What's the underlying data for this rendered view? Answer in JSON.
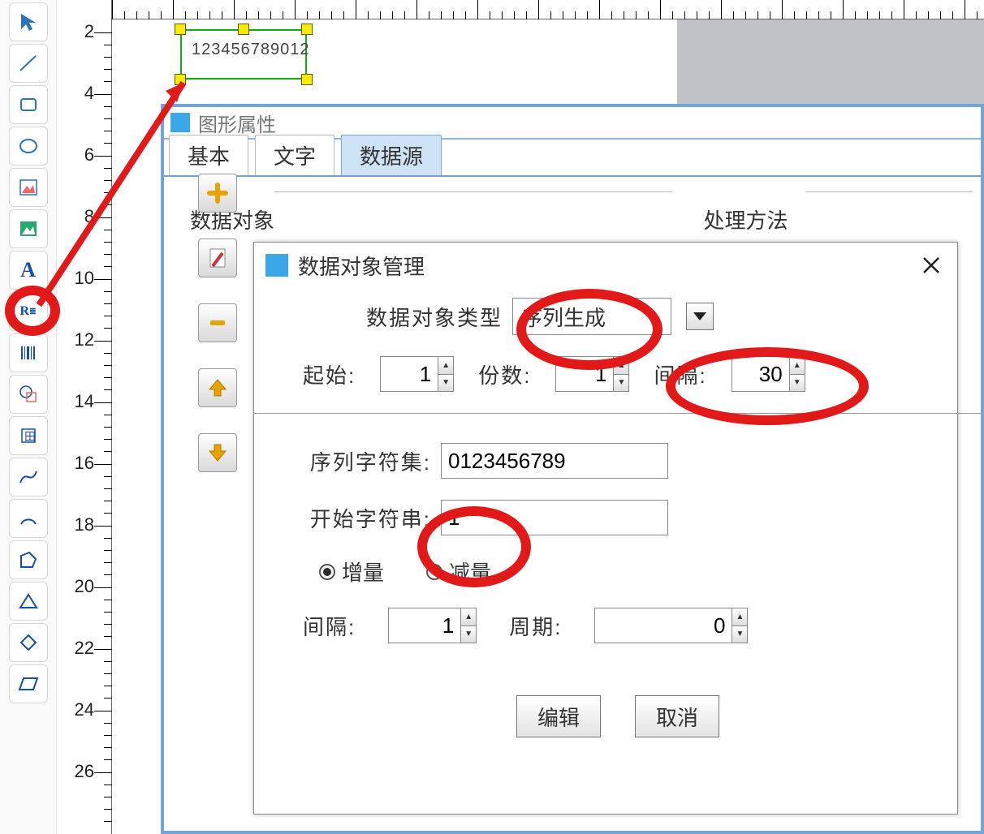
{
  "canvas": {
    "selected_text": "123456789012"
  },
  "ruler": {
    "v_ticks": [
      "2",
      "4",
      "6",
      "8",
      "10",
      "12",
      "14",
      "16",
      "18",
      "20",
      "22",
      "24",
      "26"
    ]
  },
  "prop_panel": {
    "title": "图形属性",
    "tabs": {
      "basic": "基本",
      "text": "文字",
      "datasrc": "数据源"
    },
    "group_left": "数据对象",
    "group_right": "处理方法"
  },
  "side_buttons": {
    "add": "＋",
    "edit": "✎",
    "remove": "−",
    "up": "↑",
    "down": "↓"
  },
  "dlg": {
    "title": "数据对象管理",
    "type_label": "数据对象类型",
    "type_value": "序列生成",
    "start_label": "起始:",
    "start_value": "1",
    "copies_label": "份数:",
    "copies_value": "1",
    "interval1_label": "间隔:",
    "interval1_value": "30",
    "charset_label": "序列字符集:",
    "charset_value": "0123456789",
    "startstr_label": "开始字符串:",
    "startstr_value": "1",
    "radio_inc": "增量",
    "radio_dec": "减量",
    "interval2_label": "间隔:",
    "interval2_value": "1",
    "period_label": "周期:",
    "period_value": "0",
    "btn_edit": "编辑",
    "btn_cancel": "取消"
  },
  "tools": [
    "pointer",
    "line",
    "rect",
    "ellipse",
    "image",
    "picture",
    "text",
    "rich-text",
    "barcode",
    "combine",
    "stamp",
    "curve",
    "arc",
    "polygon",
    "triangle",
    "diamond",
    "parallelogram"
  ]
}
